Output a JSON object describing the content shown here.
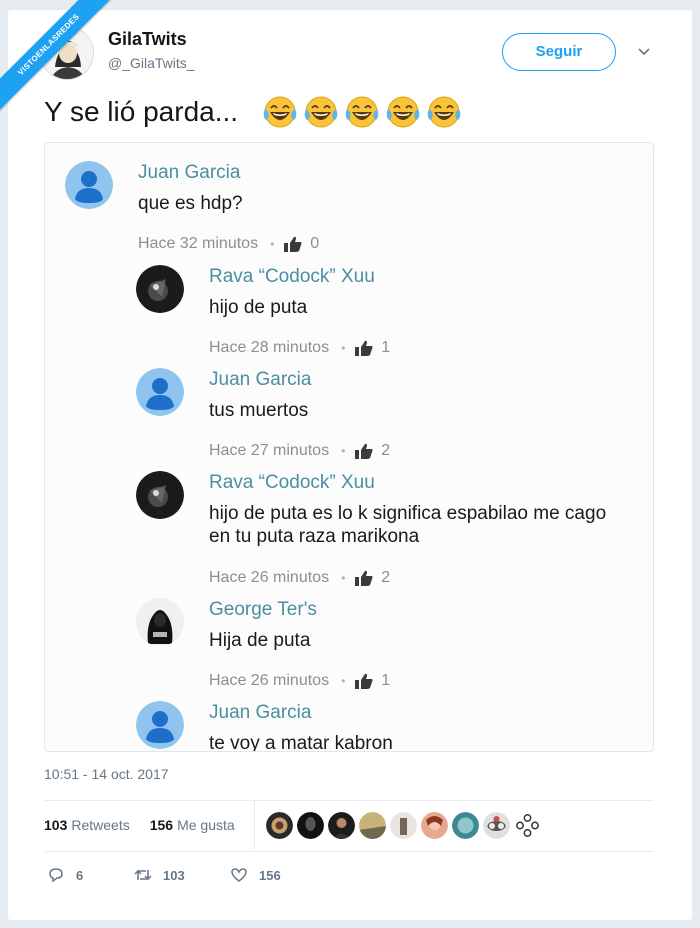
{
  "watermark": {
    "text": "VISTOENLASREDES",
    "sub": ".com"
  },
  "author": {
    "name": "GilaTwits",
    "handle": "@_GilaTwits_"
  },
  "follow_label": "Seguir",
  "tweet_text": "Y se lió parda...",
  "emoji_icon": "face-with-tears-of-joy",
  "comments": [
    {
      "name": "Juan Garcia",
      "text": "que es hdp?",
      "time": "Hace 32 minutos",
      "likes": "0"
    },
    {
      "name": "Rava “Codock” Xuu",
      "text": "hijo de puta",
      "time": "Hace 28 minutos",
      "likes": "1"
    },
    {
      "name": "Juan Garcia",
      "text": "tus muertos",
      "time": "Hace 27 minutos",
      "likes": "2"
    },
    {
      "name": "Rava “Codock” Xuu",
      "text": "hijo de puta es lo k significa espabilao me cago",
      "text2": "en tu puta raza marikona",
      "time": "Hace 26 minutos",
      "likes": "2"
    },
    {
      "name": "George Ter's",
      "text": "Hija de puta",
      "time": "Hace 26 minutos",
      "likes": "1"
    },
    {
      "name": "Juan Garcia",
      "text": "te voy a matar kabron"
    }
  ],
  "timestamp": "10:51 - 14 oct. 2017",
  "stats": {
    "retweets_count": "103",
    "retweets_label": "Retweets",
    "likes_count": "156",
    "likes_label": "Me gusta"
  },
  "actions": {
    "replies": "6",
    "retweets": "103",
    "likes": "156"
  },
  "colors": {
    "accent": "#1da1f2",
    "comment_name": "#4a8fa0",
    "muted": "#657786"
  }
}
